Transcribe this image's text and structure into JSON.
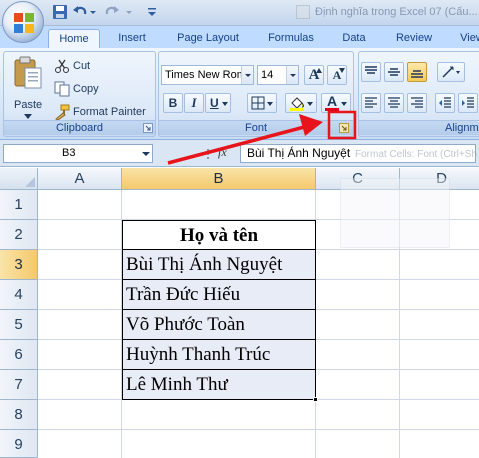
{
  "quick_access": {
    "icons": [
      "save-icon",
      "undo-icon",
      "redo-icon",
      "customize-icon"
    ]
  },
  "window": {
    "doc_title": "Định nghĩa trong Excel 07 (Cấu..."
  },
  "tabs": [
    "Home",
    "Insert",
    "Page Layout",
    "Formulas",
    "Data",
    "Review",
    "View"
  ],
  "ribbon": {
    "clipboard": {
      "label": "Clipboard",
      "paste_label": "Paste",
      "cut_label": "Cut",
      "copy_label": "Copy",
      "format_painter_label": "Format Painter"
    },
    "font": {
      "label": "Font",
      "font_name": "Times New Rom",
      "font_size": "14",
      "bold": "B",
      "italic": "I",
      "underline": "U",
      "font_color_letter": "A",
      "grow_letter": "A",
      "shrink_letter": "A"
    },
    "alignment": {
      "label": "Alignm"
    }
  },
  "formula_bar": {
    "name_box": "B3",
    "fx": "fx",
    "content": "Bùi Thị Ánh Nguyệt",
    "tooltip": "Format Cells: Font (Ctrl+Sh"
  },
  "sheet": {
    "columns": [
      "A",
      "B",
      "C",
      "D"
    ],
    "selected_column": "B",
    "rows": [
      "1",
      "2",
      "3",
      "4",
      "5",
      "6",
      "7",
      "8",
      "9"
    ],
    "selected_row": "3",
    "table_header": "Họ và tên",
    "names": [
      "Bùi Thị Ánh Nguyệt",
      "Trần Đức Hiếu",
      "Võ Phước Toàn",
      "Huỳnh Thanh Trúc",
      "Lê Minh Thư"
    ]
  },
  "annotation": {
    "color": "#e8141b",
    "target": "font-dialog-launcher"
  }
}
